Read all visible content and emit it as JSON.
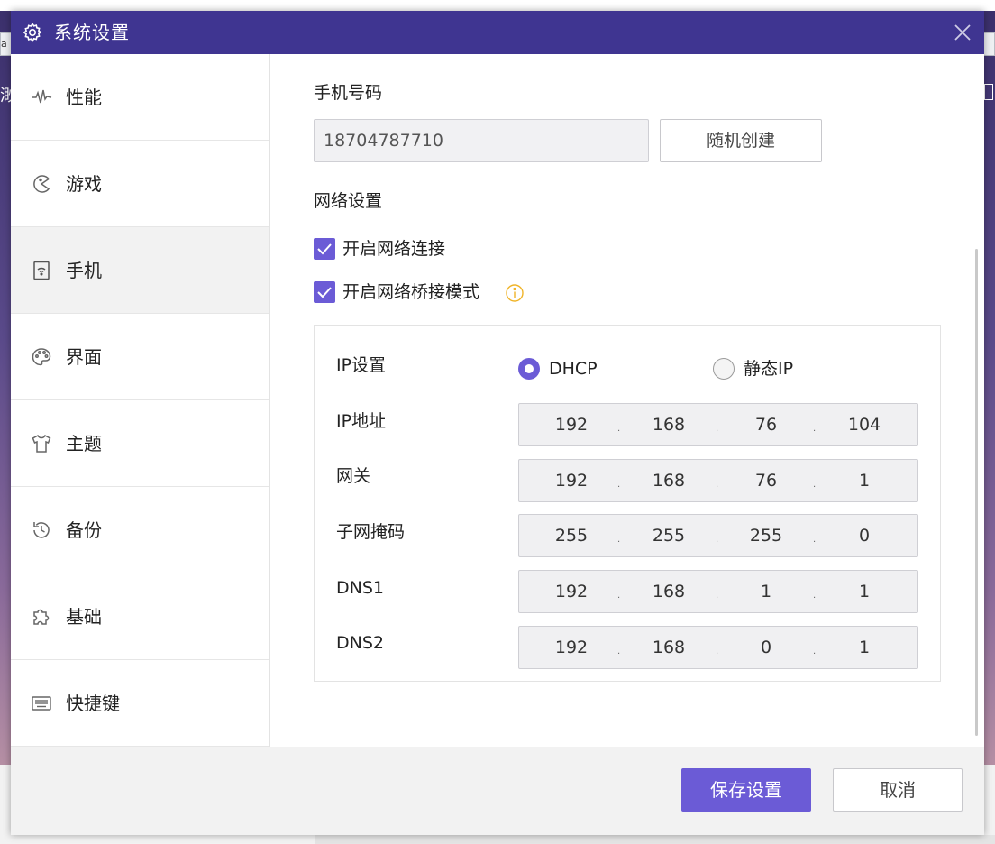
{
  "window": {
    "title": "系统设置"
  },
  "background": {
    "left_tab_text": "a创",
    "left_char": "渺"
  },
  "sidebar": {
    "items": [
      {
        "label": "性能",
        "icon": "pulse-icon"
      },
      {
        "label": "游戏",
        "icon": "pacman-icon"
      },
      {
        "label": "手机",
        "icon": "phone-wifi-icon"
      },
      {
        "label": "界面",
        "icon": "palette-icon"
      },
      {
        "label": "主题",
        "icon": "shirt-icon"
      },
      {
        "label": "备份",
        "icon": "history-icon"
      },
      {
        "label": "基础",
        "icon": "puzzle-icon"
      },
      {
        "label": "快捷键",
        "icon": "keyboard-icon"
      }
    ],
    "active": "手机"
  },
  "phone": {
    "label": "手机号码",
    "value": "18704787710",
    "random_button": "随机创建"
  },
  "network": {
    "label": "网络设置",
    "enable_network": {
      "label": "开启网络连接",
      "checked": true
    },
    "enable_bridge": {
      "label": "开启网络桥接模式",
      "checked": true
    }
  },
  "ip": {
    "mode_label": "IP设置",
    "options": [
      {
        "label": "DHCP",
        "selected": true
      },
      {
        "label": "静态IP",
        "selected": false
      }
    ],
    "rows": [
      {
        "label": "IP地址",
        "octets": [
          "192",
          "168",
          "76",
          "104"
        ]
      },
      {
        "label": "网关",
        "octets": [
          "192",
          "168",
          "76",
          "1"
        ]
      },
      {
        "label": "子网掩码",
        "octets": [
          "255",
          "255",
          "255",
          "0"
        ]
      },
      {
        "label": "DNS1",
        "octets": [
          "192",
          "168",
          "1",
          "1"
        ]
      },
      {
        "label": "DNS2",
        "octets": [
          "192",
          "168",
          "0",
          "1"
        ]
      }
    ],
    "separator": "."
  },
  "footer": {
    "save_label": "保存设置",
    "cancel_label": "取消"
  },
  "colors": {
    "titlebar": "#3f3591",
    "accent": "#6b5bd6",
    "info": "#f0b429"
  }
}
